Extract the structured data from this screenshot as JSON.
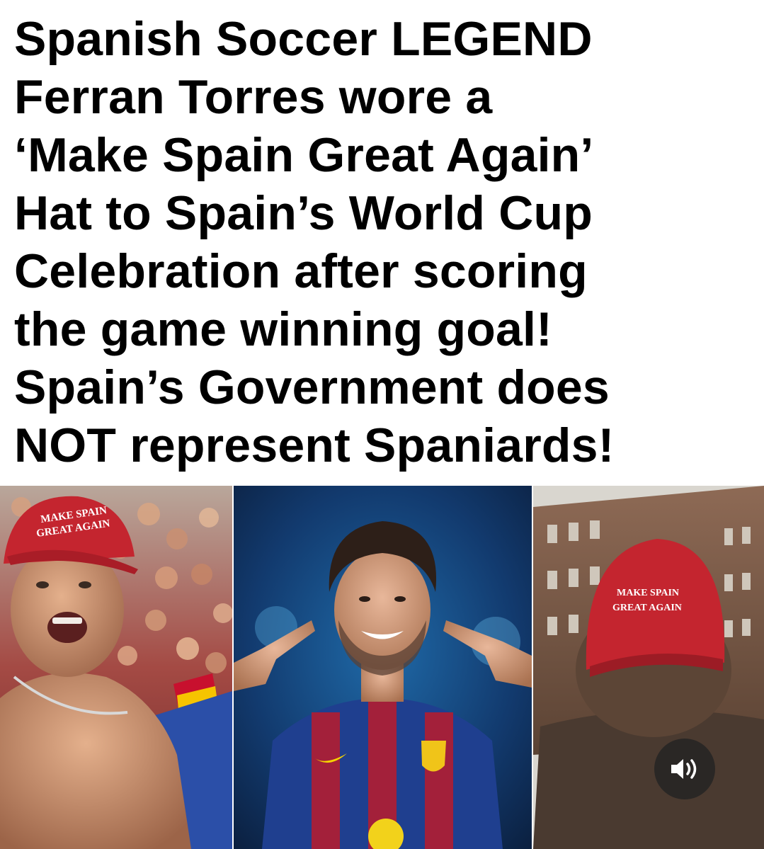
{
  "headline": {
    "lines": [
      "Spanish Soccer LEGEND",
      "Ferran Torres wore a",
      "‘Make Spain Great Again’",
      "Hat to Spain’s World Cup",
      "Celebration after scoring",
      "the game winning goal!",
      "Spain’s Government does",
      "NOT represent Spaniards!"
    ]
  },
  "photos": {
    "left": {
      "icon": "man-in-red-cap-crowd-photo",
      "hat_line1": "MAKE SPAIN",
      "hat_line2": "GREAT AGAIN"
    },
    "center": {
      "icon": "soccer-player-pointing-photo"
    },
    "right": {
      "icon": "man-in-red-cap-back-photo",
      "hat_line1": "MAKE SPAIN",
      "hat_line2": "GREAT AGAIN"
    }
  },
  "controls": {
    "sound_icon": "speaker-volume-icon"
  },
  "colors": {
    "hat_red": "#c4252f",
    "shirt_blue": "#1f3f8f",
    "shirt_red": "#a3203a",
    "text": "#000000"
  }
}
